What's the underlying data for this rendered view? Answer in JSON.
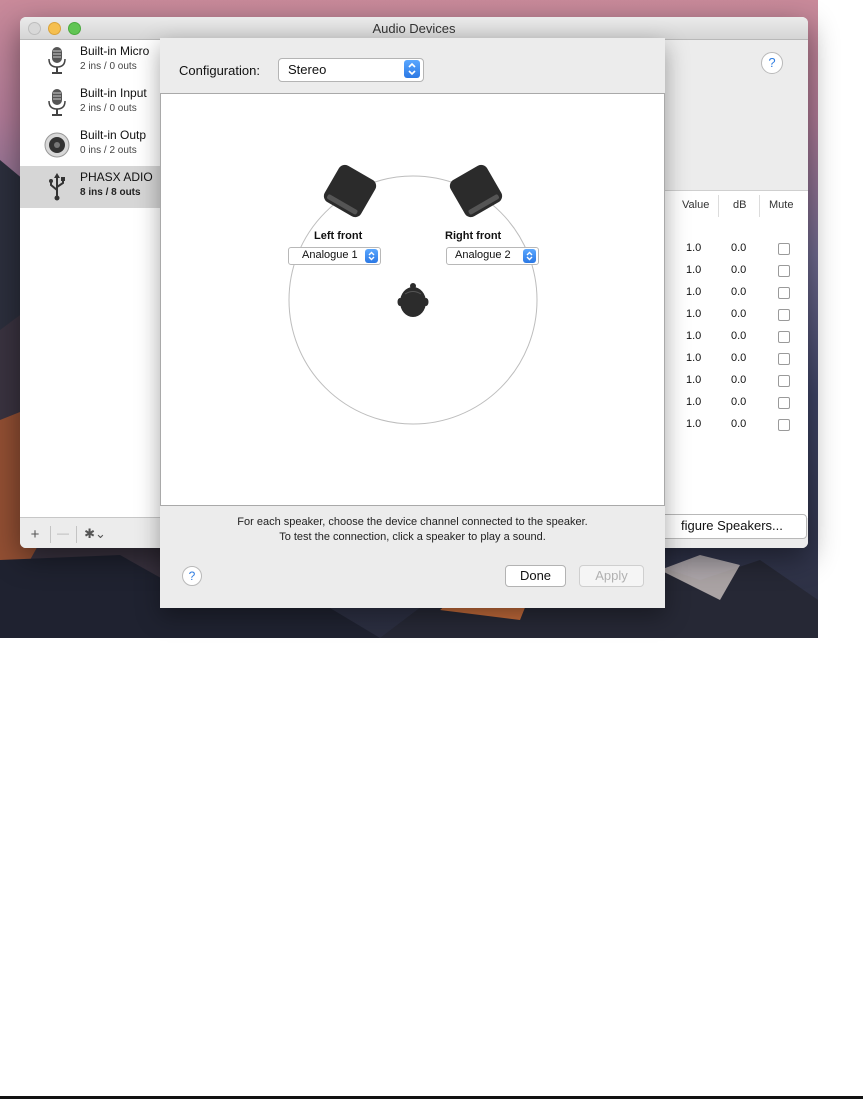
{
  "window": {
    "title": "Audio Devices"
  },
  "devices": [
    {
      "name": "Built-in Micro",
      "sub": "2 ins / 0 outs",
      "icon": "microphone-icon"
    },
    {
      "name": "Built-in Input",
      "sub": "2 ins / 0 outs",
      "icon": "microphone-icon"
    },
    {
      "name": "Built-in Outp",
      "sub": "0 ins / 2 outs",
      "icon": "speaker-icon"
    },
    {
      "name": "PHASX ADIO",
      "sub": "8 ins / 8 outs",
      "icon": "usb-icon",
      "selected": true
    }
  ],
  "toolbar": {
    "add_label": "+",
    "remove_label": "—",
    "gear_label": "✱⌄"
  },
  "help": {
    "top_label": "?",
    "bottom_label": "?"
  },
  "table": {
    "headers": {
      "value": "Value",
      "db": "dB",
      "mute": "Mute"
    },
    "rows": [
      {
        "value": "1.0",
        "db": "0.0"
      },
      {
        "value": "1.0",
        "db": "0.0"
      },
      {
        "value": "1.0",
        "db": "0.0"
      },
      {
        "value": "1.0",
        "db": "0.0"
      },
      {
        "value": "1.0",
        "db": "0.0"
      },
      {
        "value": "1.0",
        "db": "0.0"
      },
      {
        "value": "1.0",
        "db": "0.0"
      },
      {
        "value": "1.0",
        "db": "0.0"
      },
      {
        "value": "1.0",
        "db": "0.0"
      }
    ],
    "configure_label": "figure Speakers..."
  },
  "sheet": {
    "config_label": "Configuration:",
    "config_value": "Stereo",
    "left_speaker": {
      "label": "Left front",
      "channel": "Analogue 1"
    },
    "right_speaker": {
      "label": "Right front",
      "channel": "Analogue 2"
    },
    "instructions_line1": "For each speaker, choose the device channel connected to the speaker.",
    "instructions_line2": "To test the connection, click a speaker to play a sound.",
    "done_label": "Done",
    "apply_label": "Apply"
  },
  "colors": {
    "accent": "#2b78e4",
    "selected_row": "#d6d6d6"
  }
}
